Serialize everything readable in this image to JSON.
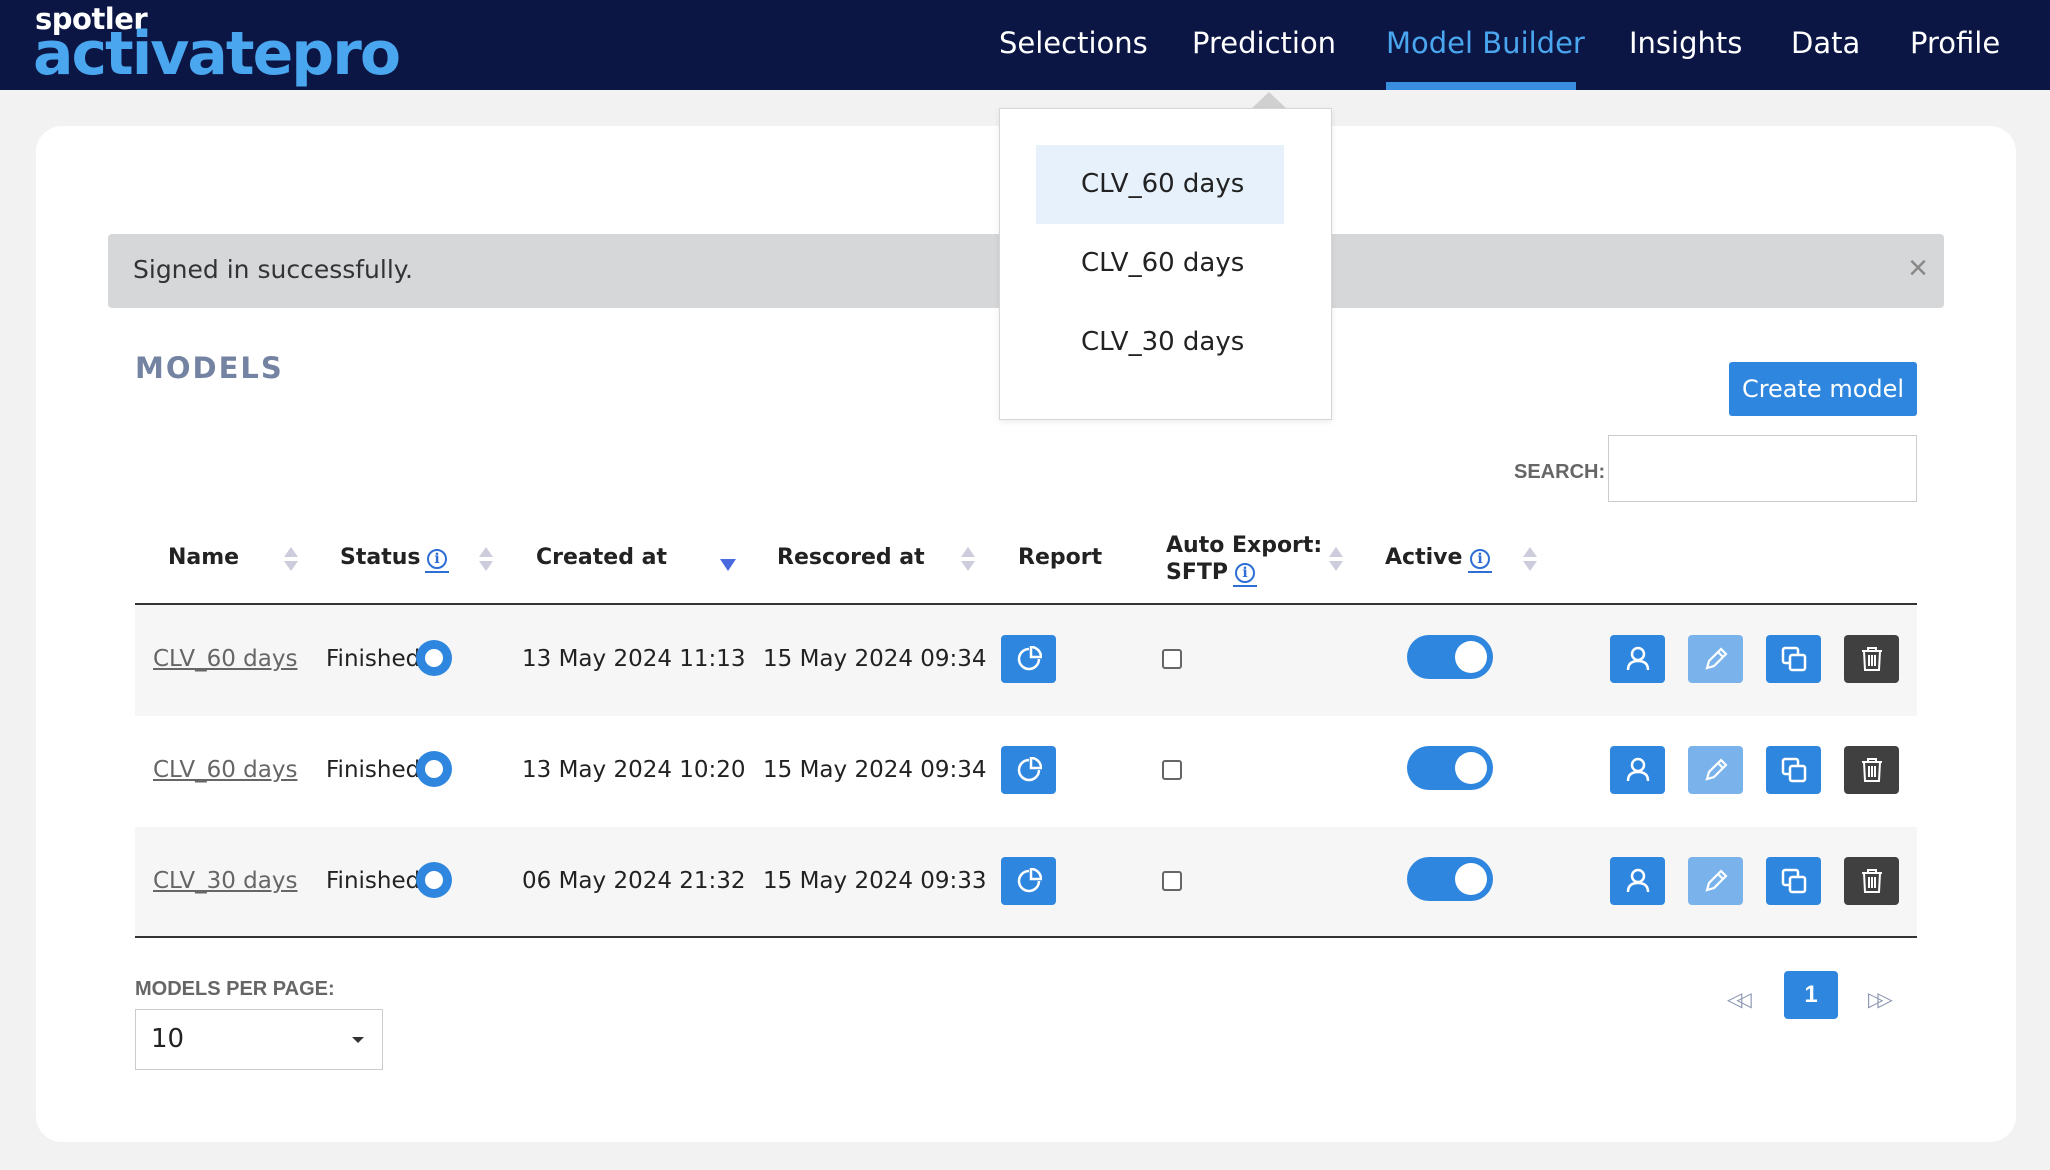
{
  "brand": {
    "small": "spotler",
    "big": "activatepro"
  },
  "nav": {
    "items": [
      {
        "label": "Selections"
      },
      {
        "label": "Prediction"
      },
      {
        "label": "Model Builder"
      },
      {
        "label": "Insights"
      },
      {
        "label": "Data"
      },
      {
        "label": "Profile"
      }
    ],
    "active": "Model Builder"
  },
  "dropdown": {
    "items": [
      {
        "label": "CLV_60 days"
      },
      {
        "label": "CLV_60 days"
      },
      {
        "label": "CLV_30 days"
      }
    ]
  },
  "alert": {
    "text": "Signed in successfully.",
    "close": "×"
  },
  "page": {
    "title": "MODELS",
    "create_label": "Create model"
  },
  "search": {
    "label": "SEARCH:",
    "value": ""
  },
  "table": {
    "headers": {
      "name": "Name",
      "status": "Status",
      "created": "Created at",
      "rescored": "Rescored at",
      "report": "Report",
      "auto_export_1": "Auto Export:",
      "auto_export_2": "SFTP",
      "active": "Active"
    },
    "rows": [
      {
        "name": "CLV_60 days",
        "status": "Finished",
        "created": "13 May 2024 11:13",
        "rescored": "15 May 2024 09:34",
        "auto_export": false,
        "active": true
      },
      {
        "name": "CLV_60 days",
        "status": "Finished",
        "created": "13 May 2024 10:20",
        "rescored": "15 May 2024 09:34",
        "auto_export": false,
        "active": true
      },
      {
        "name": "CLV_30 days",
        "status": "Finished",
        "created": "06 May 2024 21:32",
        "rescored": "15 May 2024 09:33",
        "auto_export": false,
        "active": true
      }
    ]
  },
  "footer": {
    "per_page_label": "MODELS PER PAGE:",
    "per_page_value": "10",
    "current_page": "1"
  },
  "colors": {
    "navbar": "#0b1644",
    "accent": "#2e86de",
    "brand_blue": "#4aa6ee"
  }
}
